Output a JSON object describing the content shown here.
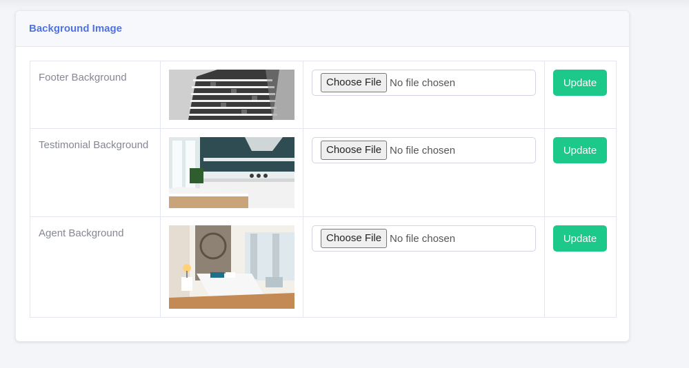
{
  "card": {
    "title": "Background Image"
  },
  "rows": [
    {
      "label": "Footer Background",
      "thumbnail": "building-facade",
      "choose_label": "Choose File",
      "file_status": "No file chosen",
      "update_label": "Update"
    },
    {
      "label": "Testimonial Background",
      "thumbnail": "kitchen-interior",
      "choose_label": "Choose File",
      "file_status": "No file chosen",
      "update_label": "Update"
    },
    {
      "label": "Agent Background",
      "thumbnail": "bedroom-interior",
      "choose_label": "Choose File",
      "file_status": "No file chosen",
      "update_label": "Update"
    }
  ],
  "colors": {
    "accent": "#4e73df",
    "success": "#1cc88a",
    "page_bg": "#f4f5f9"
  }
}
